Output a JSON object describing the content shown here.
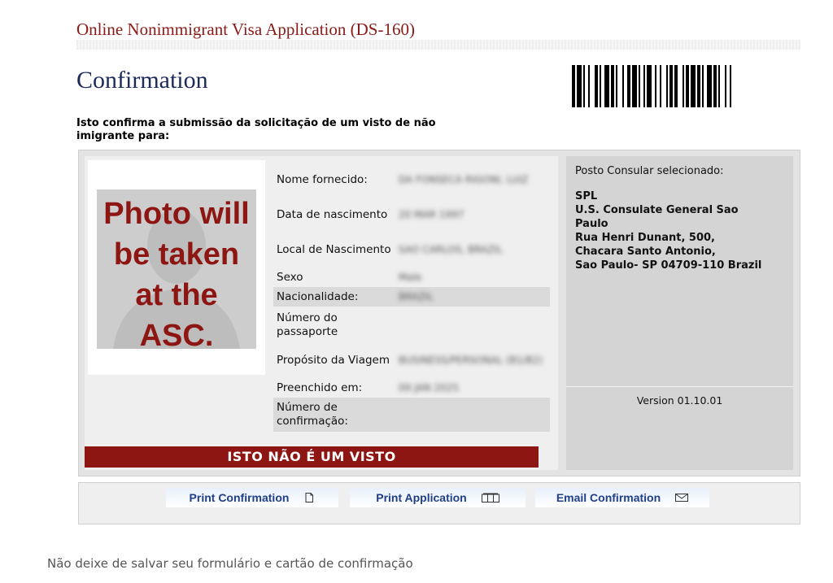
{
  "header": {
    "app_title": "Online Nonimmigrant Visa Application (DS-160)",
    "page_title": "Confirmation"
  },
  "intro_text": "Isto confirma a submissão da solicitação de um visto de não imigrante para:",
  "photo": {
    "text_lines": [
      "Photo will",
      "be taken",
      "at the",
      "ASC."
    ]
  },
  "applicant": {
    "rows": [
      {
        "label": "Nome fornecido:",
        "value": "DA FONSECA RIGONI, LUIZ"
      },
      {
        "label": "Data de nascimento",
        "value": "20 MAR 1997"
      },
      {
        "label": "Local de Nascimento",
        "value": "SAO CARLOS, BRAZIL"
      },
      {
        "label": "Sexo",
        "value": "Male"
      },
      {
        "label": "Nacionalidade:",
        "value": "BRAZIL"
      },
      {
        "label": "Número do passaporte",
        "value": ""
      },
      {
        "label": "Propósito da Viagem",
        "value": "BUSINESS/PERSONAL (B1/B2)"
      },
      {
        "label": "Preenchido em:",
        "value": "09 JAN 2025"
      },
      {
        "label": "Número de confirmação:",
        "value": ""
      }
    ]
  },
  "not_visa_banner": "ISTO NÃO É UM VISTO",
  "consular_post": {
    "label": "Posto Consular selecionado:",
    "lines": [
      "SPL",
      "U.S. Consulate General Sao",
      "Paulo",
      "Rua Henri Dunant, 500,",
      "Chacara Santo Antonio,",
      "Sao Paulo- SP 04709-110 Brazil"
    ]
  },
  "version": "Version 01.10.01",
  "buttons": {
    "print_confirmation": "Print Confirmation",
    "print_application": "Print Application",
    "email_confirmation": "Email Confirmation"
  },
  "icons": {
    "print_confirmation": "document-icon",
    "print_application": "pages-icon",
    "email_confirmation": "envelope-icon"
  },
  "footer_note": "Não deixe de salvar seu formulário e cartão de confirmação",
  "colors": {
    "brand_red": "#8d1612",
    "title_navy": "#1c2a5a",
    "button_text": "#1f3f8a"
  }
}
